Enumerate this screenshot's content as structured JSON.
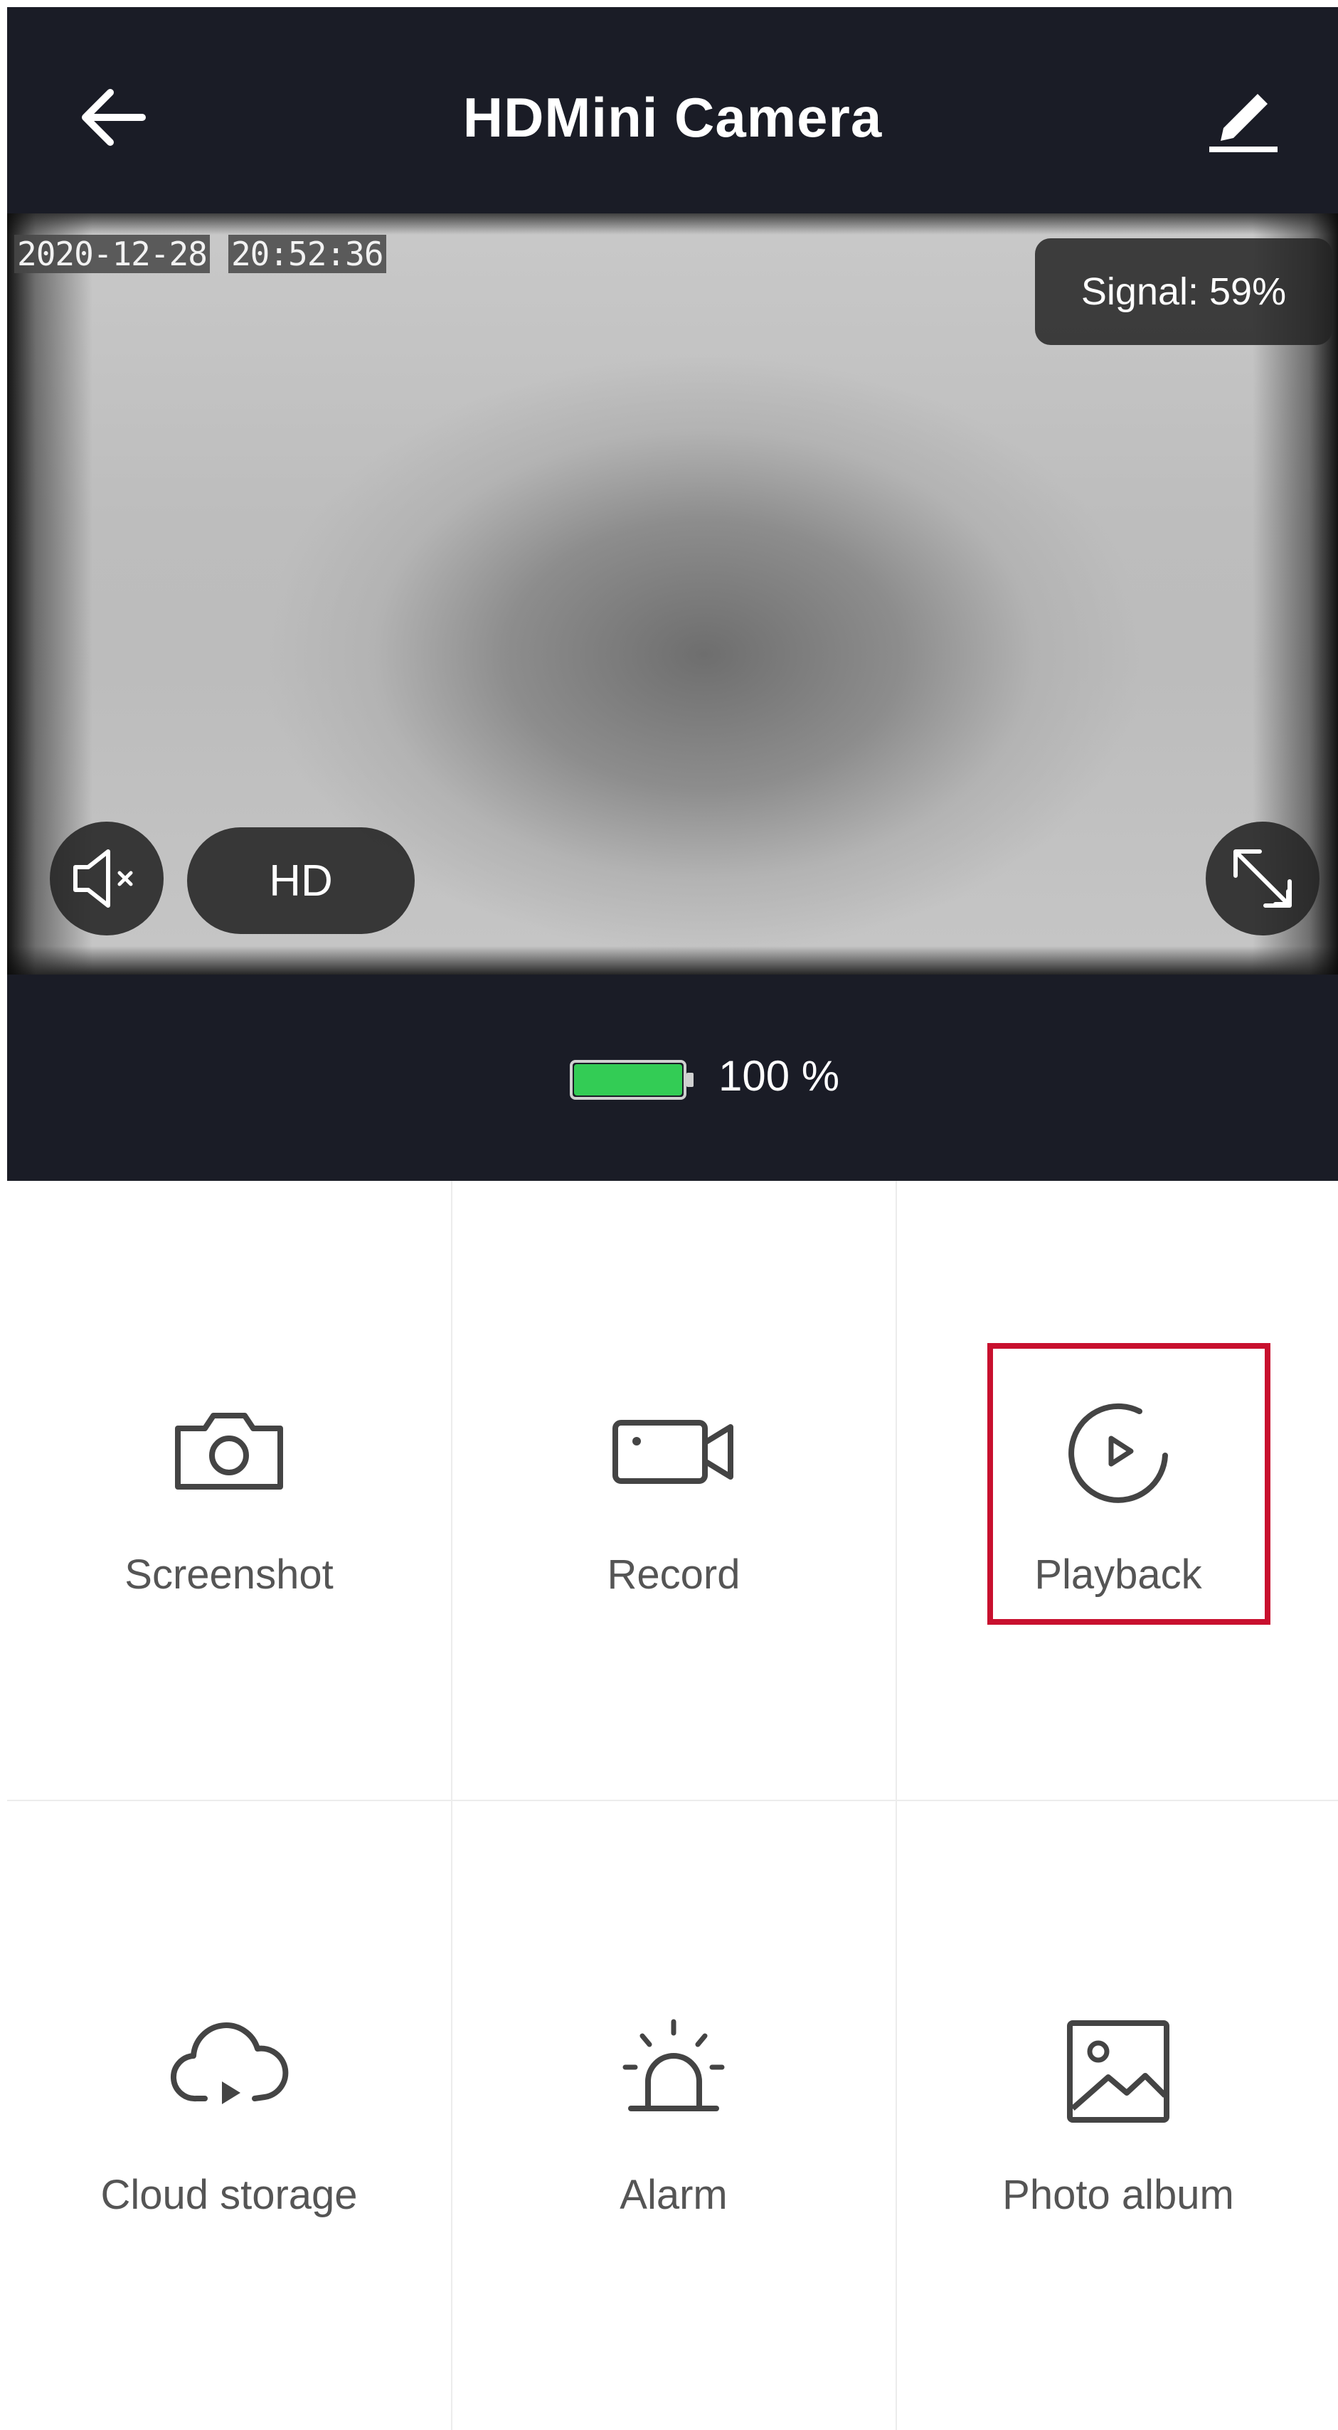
{
  "header": {
    "title": "HDMini Camera",
    "background": "#1a1c26"
  },
  "video": {
    "date": "2020-12-28",
    "time": "20:52:36",
    "signal": "Signal: 59%",
    "quality": "HD"
  },
  "battery": {
    "level_text": "100 %",
    "level_percent": 100,
    "color": "#33cc55"
  },
  "functions": [
    {
      "label": "Screenshot",
      "icon": "camera-icon"
    },
    {
      "label": "Record",
      "icon": "video-camera-icon"
    },
    {
      "label": "Playback",
      "icon": "playback-icon"
    },
    {
      "label": "Cloud storage",
      "icon": "cloud-play-icon"
    },
    {
      "label": "Alarm",
      "icon": "alarm-siren-icon"
    },
    {
      "label": "Photo album",
      "icon": "image-icon"
    }
  ],
  "highlight_color": "#c8102e"
}
